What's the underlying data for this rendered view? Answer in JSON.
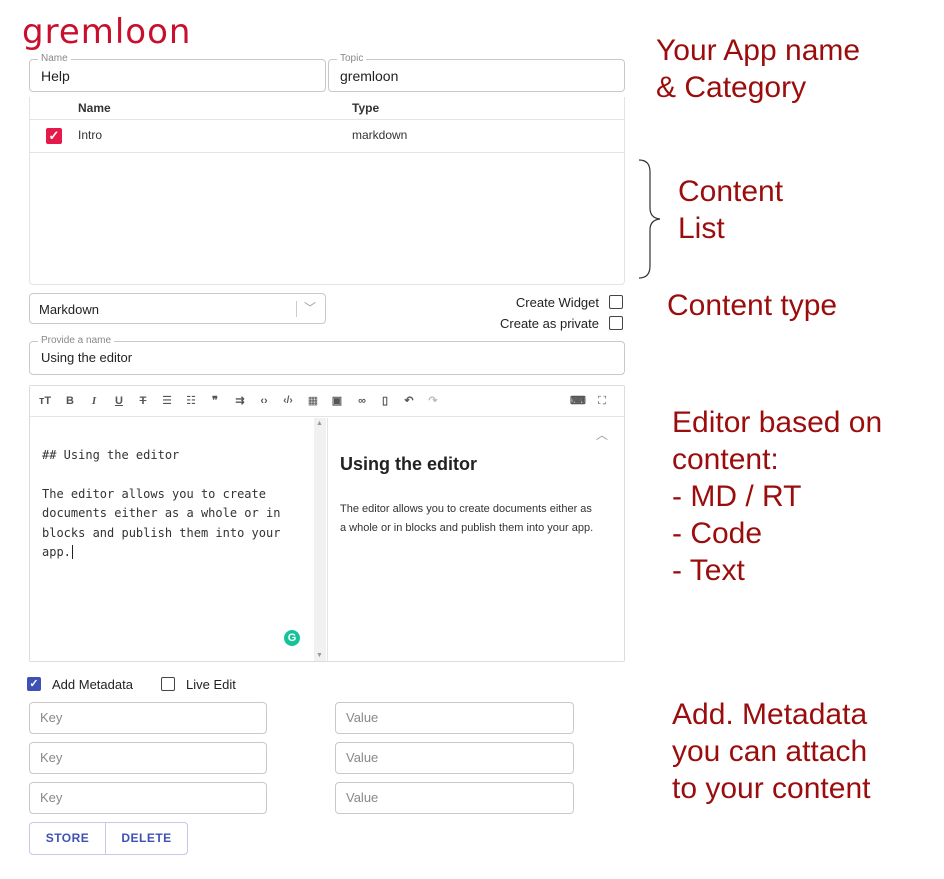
{
  "app": {
    "logo": "gremloon"
  },
  "form": {
    "name": {
      "label": "Name",
      "value": "Help"
    },
    "topic": {
      "label": "Topic",
      "value": "gremloon"
    }
  },
  "content_table": {
    "columns": [
      "Name",
      "Type"
    ],
    "rows": [
      {
        "name": "Intro",
        "type": "markdown",
        "checked": true
      }
    ]
  },
  "content_type": {
    "selected": "Markdown"
  },
  "options": {
    "create_widget": "Create Widget",
    "create_private": "Create as private"
  },
  "block_name": {
    "label": "Provide a name",
    "value": "Using the editor"
  },
  "toolbar": {
    "icons": [
      "heading-icon",
      "bold-icon",
      "italic-icon",
      "underline-icon",
      "strikethrough-icon",
      "bullet-list-icon",
      "numbered-list-icon",
      "quote-icon",
      "indent-icon",
      "code-icon",
      "code-block-icon",
      "table-icon",
      "image-icon",
      "link-icon",
      "delete-icon",
      "undo-icon",
      "redo-icon"
    ],
    "right_icons": [
      "keyboard-icon",
      "fullscreen-icon"
    ]
  },
  "editor": {
    "markdown_lines": [
      "## Using the editor",
      "",
      "The editor allows you to create",
      "documents either as a whole or in",
      "blocks and publish them into your",
      "app."
    ],
    "preview_heading": "Using the editor",
    "preview_text_1": "The editor allows you to create documents either as",
    "preview_text_2": "a whole or in blocks and publish them into your app."
  },
  "metadata": {
    "add_metadata": {
      "label": "Add Metadata",
      "checked": true
    },
    "live_edit": {
      "label": "Live Edit",
      "checked": false
    },
    "key_placeholder": "Key",
    "value_placeholder": "Value"
  },
  "buttons": {
    "store": "STORE",
    "delete": "DELETE"
  },
  "annotations": {
    "app_name_1": "Your App name",
    "app_name_2": "& Category",
    "content_list_1": "Content",
    "content_list_2": "List",
    "content_type": "Content type",
    "editor_1": "Editor based on",
    "editor_2": "content:",
    "editor_3": "- MD / RT",
    "editor_4": "- Code",
    "editor_5": "- Text",
    "metadata_1": "Add. Metadata",
    "metadata_2": "you can attach",
    "metadata_3": "to your content"
  },
  "colors": {
    "brand": "#c8102e",
    "annotation": "#9b0d0d",
    "accent": "#3f51b5",
    "check": "#e5194a",
    "grammarly": "#15c39a"
  }
}
